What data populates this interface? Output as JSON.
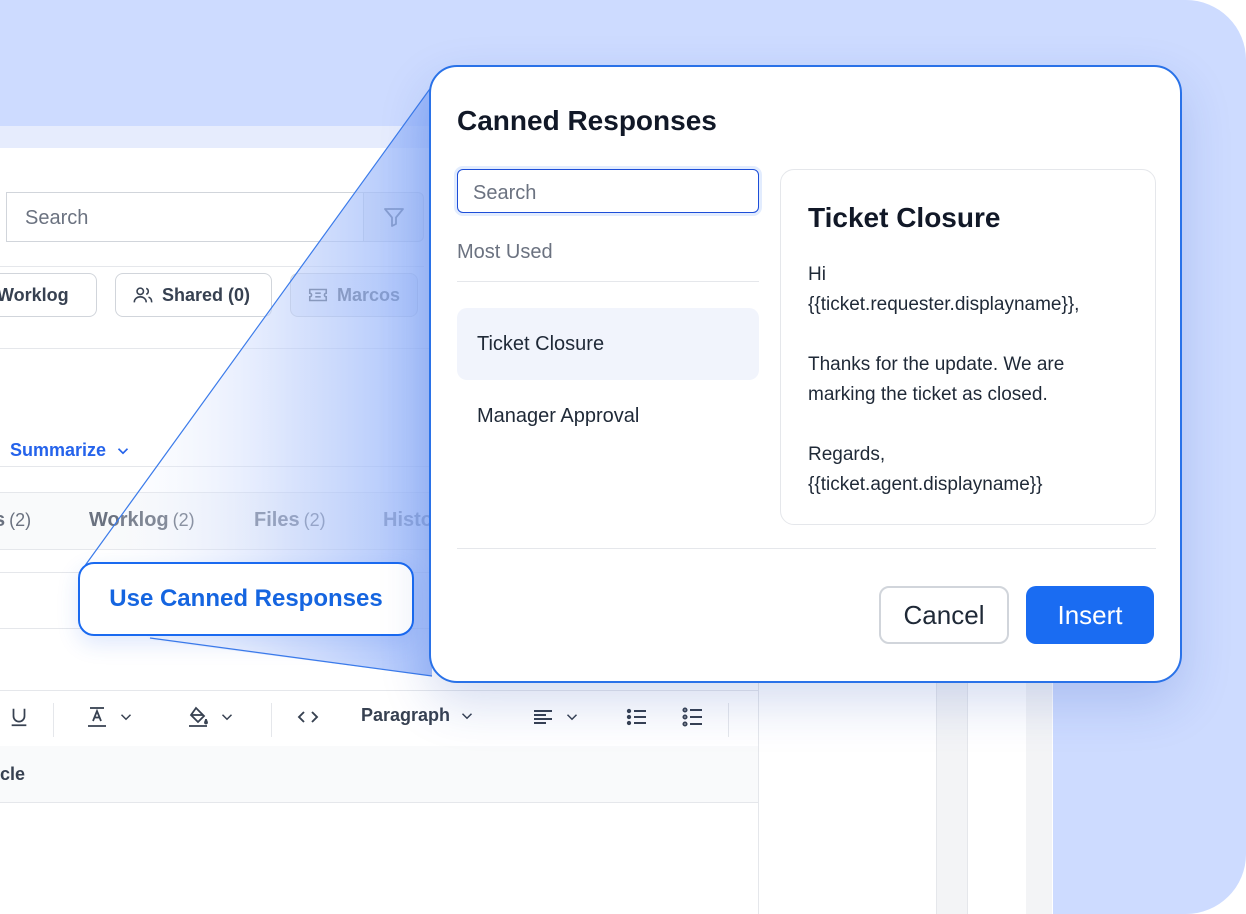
{
  "background": {
    "search": {
      "placeholder": "Search"
    },
    "chips": [
      {
        "label": "Worklog",
        "icon": "worklog-icon"
      },
      {
        "label": "Shared (0)",
        "icon": "users-icon"
      },
      {
        "label": "Marcos",
        "icon": "ticket-icon"
      }
    ],
    "summarize_label": "Summarize",
    "tabs": [
      {
        "label": "s",
        "count": "(2)"
      },
      {
        "label": "Worklog",
        "count": "(2)"
      },
      {
        "label": "Files",
        "count": "(2)"
      },
      {
        "label": "Histo",
        "count": ""
      }
    ],
    "toolbar": {
      "paragraph_label": "Paragraph"
    },
    "article_label": "cle"
  },
  "callout": {
    "label": "Use Canned Responses"
  },
  "modal": {
    "title": "Canned Responses",
    "search_placeholder": "Search",
    "section_label": "Most Used",
    "items": [
      {
        "label": "Ticket Closure",
        "selected": true
      },
      {
        "label": "Manager Approval",
        "selected": false
      }
    ],
    "preview": {
      "title": "Ticket Closure",
      "greeting": "Hi",
      "requester": "{{ticket.requester.displayname}},",
      "body1": "Thanks for the update. We are",
      "body2": "marking the ticket as closed.",
      "signoff": "Regards,",
      "agent": "{{ticket.agent.displayname}}"
    },
    "cancel_label": "Cancel",
    "insert_label": "Insert"
  },
  "colors": {
    "accent": "#1a6cf2",
    "backdrop": "#cddbff",
    "link": "#2563eb"
  }
}
